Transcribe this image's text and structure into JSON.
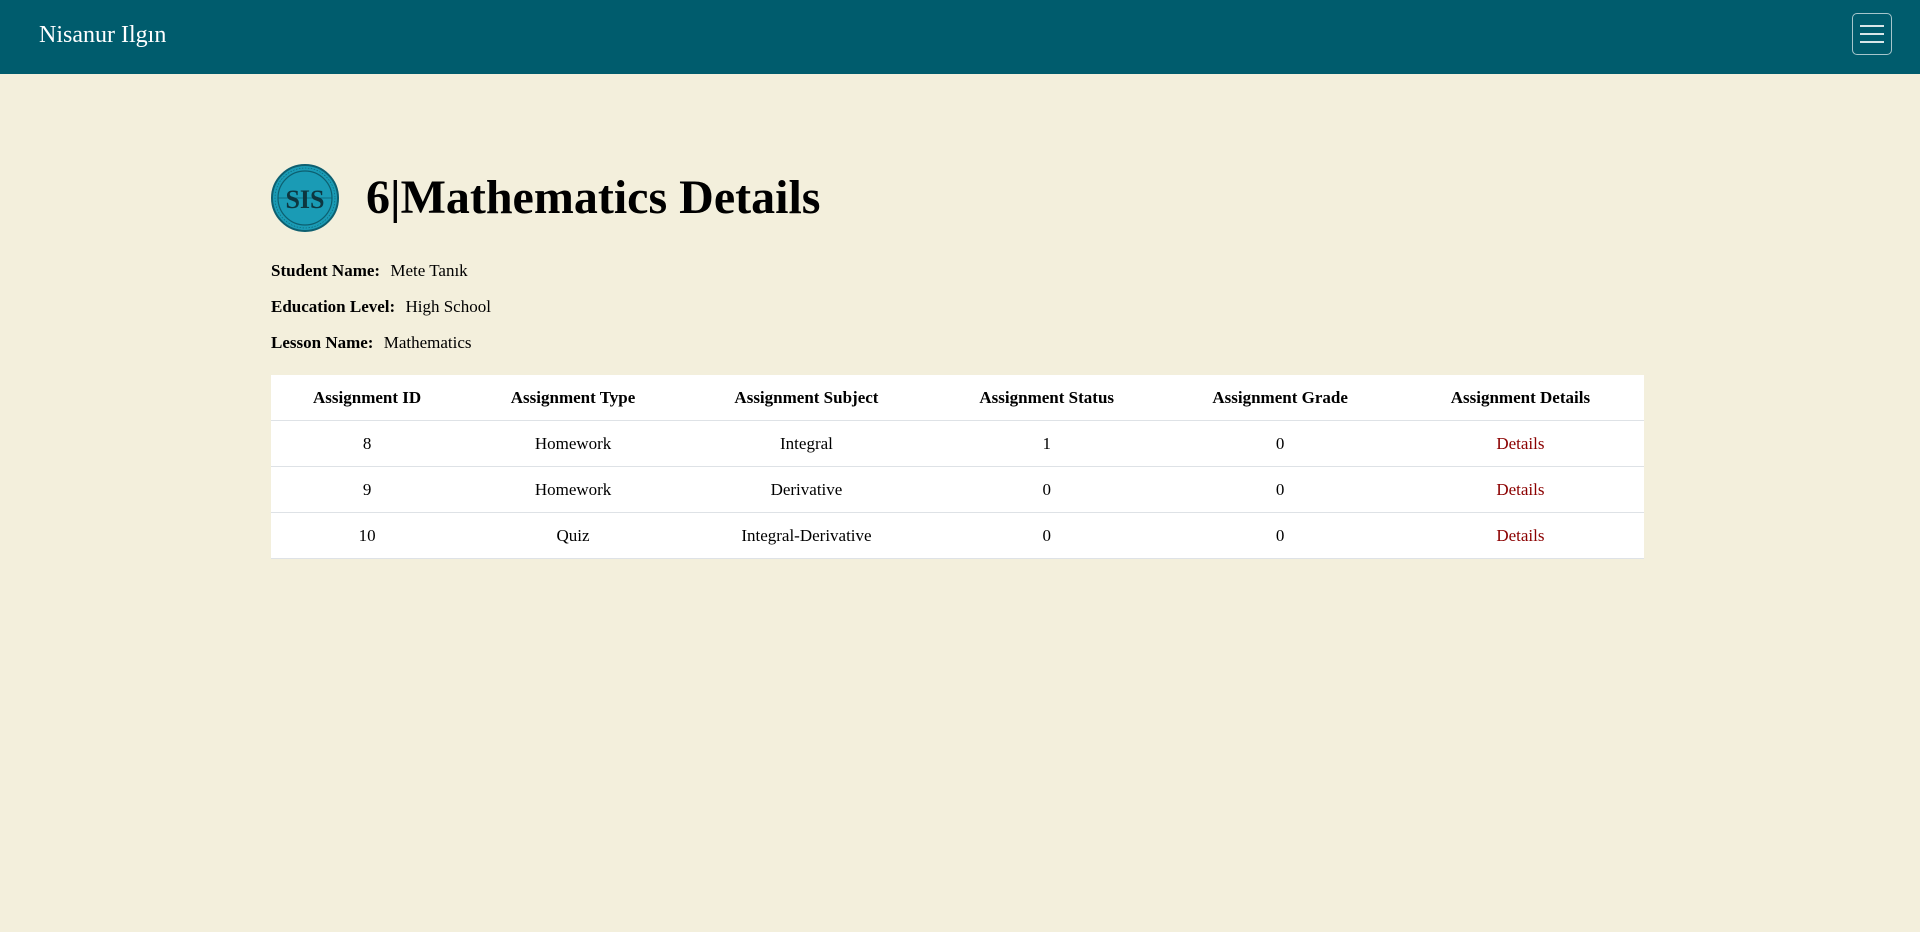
{
  "navbar": {
    "brand": "Nisanur Ilgın",
    "menu_icon": "hamburger-menu-icon",
    "background_color": "#005c6d"
  },
  "page": {
    "title": "6|Mathematics Details",
    "logo": {
      "icon": "school-seal-logo",
      "text": "SIS",
      "color": "#1a9bb5"
    }
  },
  "info": {
    "student_name_label": "Student Name:",
    "student_name_value": "Mete Tanık",
    "education_level_label": "Education Level:",
    "education_level_value": "High School",
    "lesson_name_label": "Lesson Name:",
    "lesson_name_value": "Mathematics"
  },
  "table": {
    "headers": [
      "Assignment ID",
      "Assignment Type",
      "Assignment Subject",
      "Assignment Status",
      "Assignment Grade",
      "Assignment Details"
    ],
    "rows": [
      {
        "id": "8",
        "type": "Homework",
        "subject": "Integral",
        "status": "1",
        "grade": "0",
        "details": "Details"
      },
      {
        "id": "9",
        "type": "Homework",
        "subject": "Derivative",
        "status": "0",
        "grade": "0",
        "details": "Details"
      },
      {
        "id": "10",
        "type": "Quiz",
        "subject": "Integral-Derivative",
        "status": "0",
        "grade": "0",
        "details": "Details"
      }
    ],
    "link_color": "#8b0000"
  }
}
